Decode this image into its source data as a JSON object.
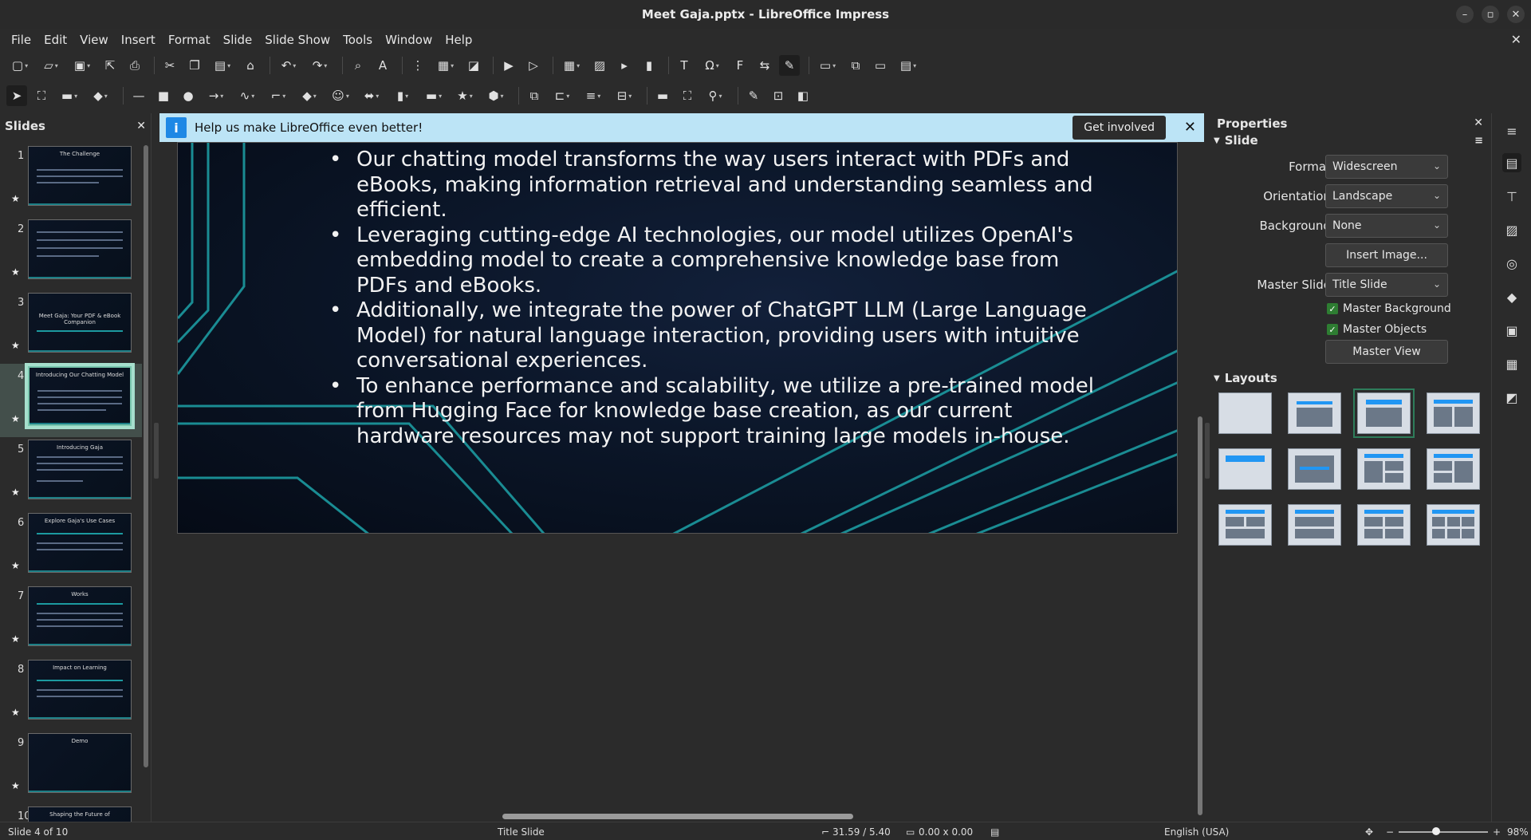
{
  "window": {
    "title": "Meet Gaja.pptx - LibreOffice Impress"
  },
  "menu": [
    "File",
    "Edit",
    "View",
    "Insert",
    "Format",
    "Slide",
    "Slide Show",
    "Tools",
    "Window",
    "Help"
  ],
  "slides_pane": {
    "title": "Slides",
    "thumbnails": [
      {
        "number": "1",
        "title": "The Challenge"
      },
      {
        "number": "2",
        "title": ""
      },
      {
        "number": "3",
        "title": "Meet Gaja: Your PDF & eBook Companion"
      },
      {
        "number": "4",
        "title": "Introducing Our Chatting Model"
      },
      {
        "number": "5",
        "title": "Introducing Gaja"
      },
      {
        "number": "6",
        "title": "Explore Gaja's Use Cases"
      },
      {
        "number": "7",
        "title": "Works"
      },
      {
        "number": "8",
        "title": "Impact on Learning"
      },
      {
        "number": "9",
        "title": "Demo"
      },
      {
        "number": "10",
        "title": "Shaping the Future of"
      }
    ]
  },
  "infobar": {
    "message": "Help us make LibreOffice even better!",
    "button": "Get involved"
  },
  "slide": {
    "bullets": [
      "Our chatting model transforms the way users interact with PDFs and eBooks, making information retrieval and understanding seamless and efficient.",
      "Leveraging cutting-edge AI technologies, our model utilizes OpenAI's embedding model to create a comprehensive knowledge base from PDFs and eBooks.",
      "Additionally, we integrate the power of ChatGPT LLM (Large Language Model) for natural language interaction, providing users with intuitive conversational experiences.",
      "To enhance performance and scalability, we utilize a pre-trained model from Hugging Face for knowledge base creation, as our current hardware resources may not support training large models in-house."
    ]
  },
  "properties": {
    "title": "Properties",
    "slide_section": "Slide",
    "format_label": "Format:",
    "format_value": "Widescreen",
    "orientation_label": "Orientation:",
    "orientation_value": "Landscape",
    "background_label": "Background:",
    "background_value": "None",
    "insert_image": "Insert Image...",
    "master_slide_label": "Master Slide:",
    "master_slide_value": "Title Slide",
    "master_background": "Master Background",
    "master_objects": "Master Objects",
    "master_view": "Master View",
    "layouts_section": "Layouts"
  },
  "statusbar": {
    "slide_info": "Slide 4 of 10",
    "master": "Title Slide",
    "position": "31.59 / 5.40",
    "size": "0.00 x 0.00",
    "language": "English (USA)",
    "zoom": "98%"
  },
  "colors": {
    "accent": "#1c9aa0",
    "infobar": "#bce4f6",
    "checkbox": "#2e7d32"
  }
}
